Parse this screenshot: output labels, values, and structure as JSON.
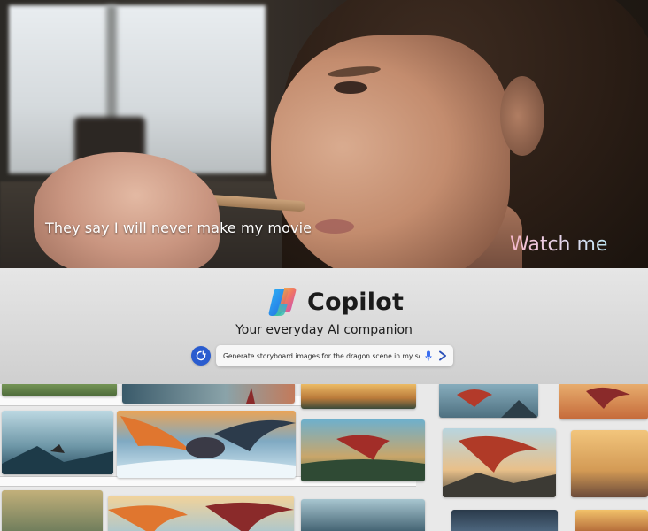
{
  "hero": {
    "caption_left": "They say I will never make my movie",
    "caption_right": "Watch me"
  },
  "copilot": {
    "brand_name": "Copilot",
    "tagline": "Your everyday AI companion",
    "prompt_text": "Generate storyboard images for the dragon scene in my script...",
    "icons": [
      "new-chat-icon",
      "microphone-icon",
      "send-icon"
    ]
  },
  "storyboard": {
    "panel_count": 14,
    "subject": "dragon"
  },
  "colors": {
    "new_chat_bg": "#2a5ccf",
    "send_arrow": "#2a4fb8",
    "mic": "#3b6ef0"
  }
}
